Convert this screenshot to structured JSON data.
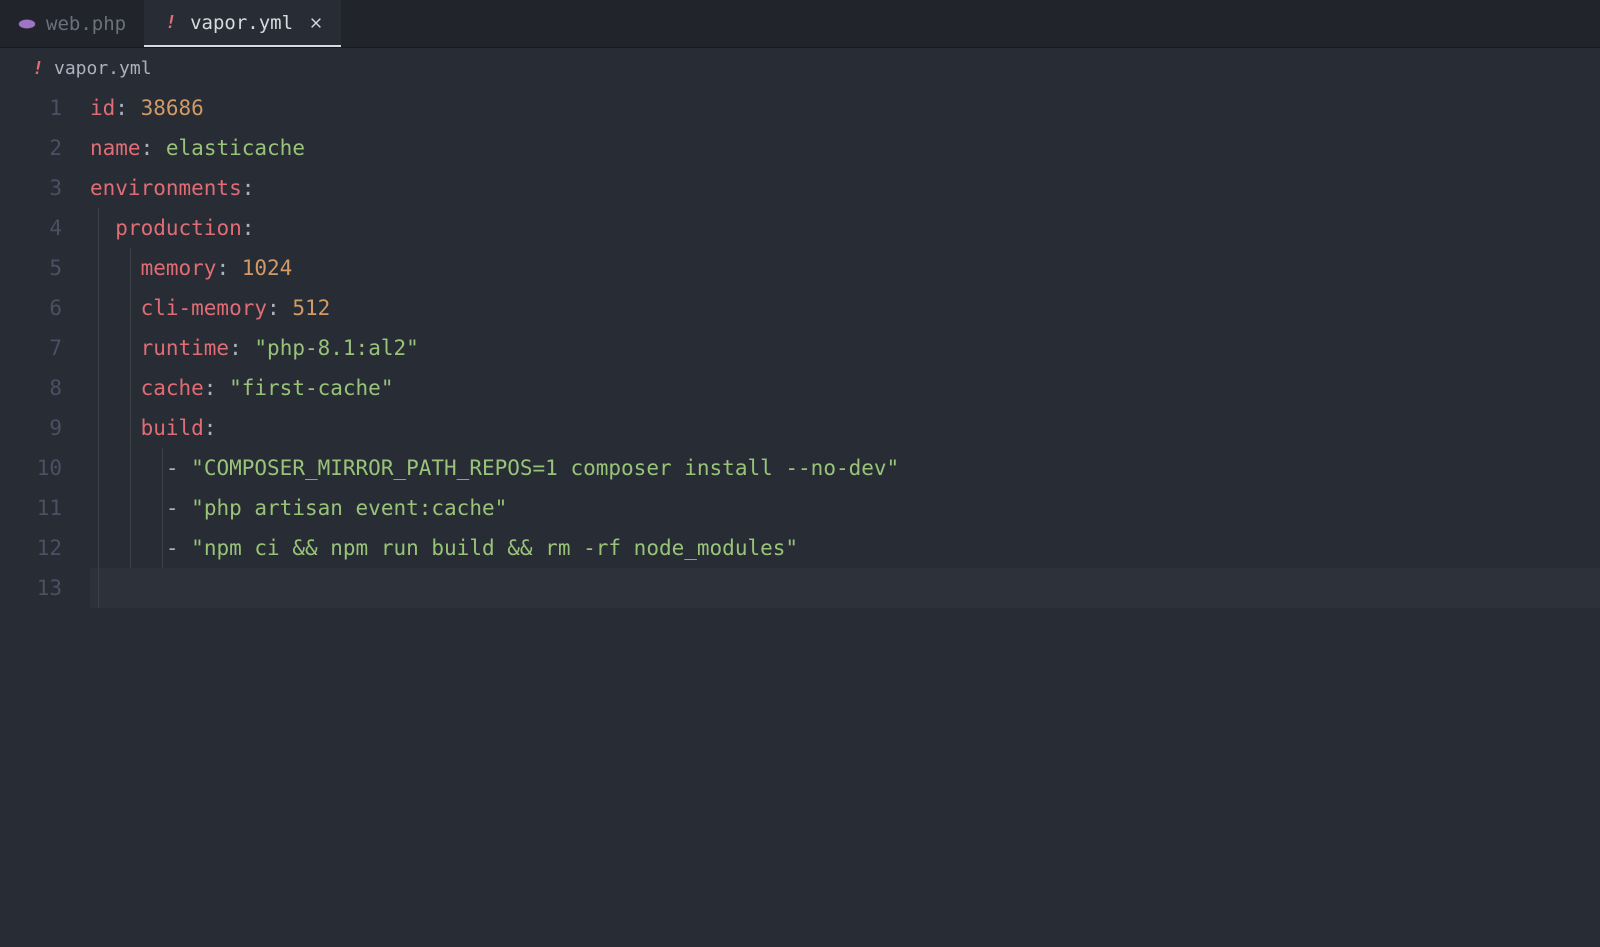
{
  "tabs": [
    {
      "label": "web.php",
      "icon": "php",
      "active": false,
      "closeable": false
    },
    {
      "label": "vapor.yml",
      "icon": "yaml",
      "active": true,
      "closeable": true
    }
  ],
  "breadcrumb": {
    "icon": "yaml",
    "label": "vapor.yml"
  },
  "gutter": {
    "lines": [
      "1",
      "2",
      "3",
      "4",
      "5",
      "6",
      "7",
      "8",
      "9",
      "10",
      "11",
      "12",
      "13"
    ]
  },
  "code": {
    "l1_key": "id",
    "l1_val": "38686",
    "l2_key": "name",
    "l2_val": "elasticache",
    "l3_key": "environments",
    "l4_key": "production",
    "l5_key": "memory",
    "l5_val": "1024",
    "l6_key": "cli-memory",
    "l6_val": "512",
    "l7_key": "runtime",
    "l7_val": "\"php-8.1:al2\"",
    "l8_key": "cache",
    "l8_val": "\"first-cache\"",
    "l9_key": "build",
    "l10_val": "\"COMPOSER_MIRROR_PATH_REPOS=1 composer install --no-dev\"",
    "l11_val": "\"php artisan event:cache\"",
    "l12_val": "\"npm ci && npm run build && rm -rf node_modules\"",
    "colon": ":",
    "dash": "-"
  }
}
